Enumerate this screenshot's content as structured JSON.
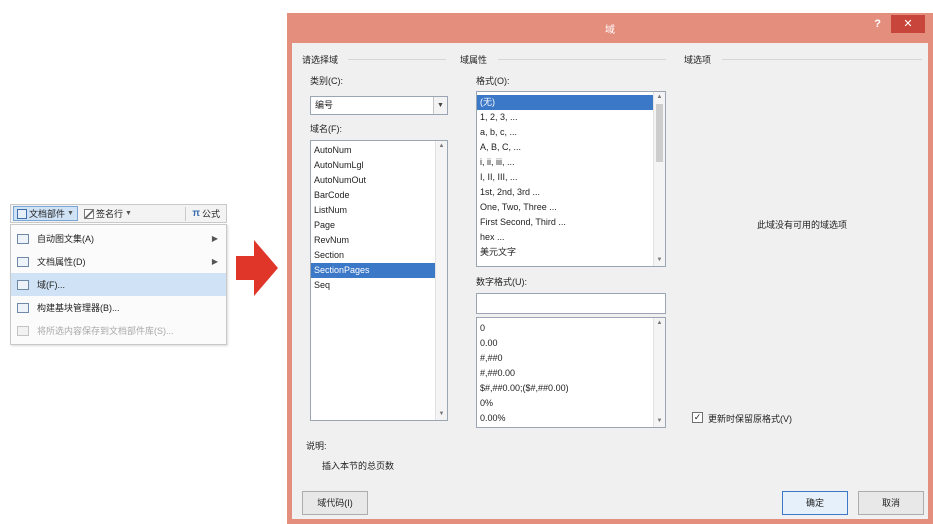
{
  "toolbar": {
    "items": [
      {
        "label": "文档部件",
        "icon": "document-parts-icon"
      },
      {
        "label": "签名行",
        "icon": "signature-line-icon"
      },
      {
        "label": "公式",
        "icon": "equation-icon"
      }
    ]
  },
  "menu": {
    "items": [
      {
        "label": "自动图文集(A)",
        "icon": "autotext-icon",
        "submenu": true
      },
      {
        "label": "文档属性(D)",
        "icon": "document-property-icon",
        "submenu": true
      },
      {
        "label": "域(F)...",
        "icon": "field-icon",
        "selected": true
      },
      {
        "label": "构建基块管理器(B)...",
        "icon": "building-blocks-icon"
      },
      {
        "label": "将所选内容保存到文档部件库(S)...",
        "icon": "save-selection-icon",
        "disabled": true
      }
    ]
  },
  "arrow_color": "#e0362a",
  "dialog": {
    "title": "域",
    "help": "?",
    "close": "✕",
    "accent": "#e48e7e",
    "choose_field": {
      "group_label": "请选择域",
      "category_label": "类别(C):",
      "category_value": "编号",
      "field_names_label": "域名(F):",
      "field_names": [
        "AutoNum",
        "AutoNumLgl",
        "AutoNumOut",
        "BarCode",
        "ListNum",
        "Page",
        "RevNum",
        "Section",
        "SectionPages",
        "Seq"
      ],
      "selected_field": "SectionPages"
    },
    "field_properties": {
      "group_label": "域属性",
      "format_label": "格式(O):",
      "formats": [
        "(无)",
        "1, 2, 3, ...",
        "a, b, c, ...",
        "A, B, C, ...",
        "i, ii, iii, ...",
        "I, II, III, ...",
        "1st, 2nd, 3rd ...",
        "One, Two, Three ...",
        "First Second, Third ...",
        "hex ...",
        "美元文字"
      ],
      "selected_format": "(无)",
      "numeric_format_label": "数字格式(U):",
      "numeric_format_value": "",
      "numeric_formats": [
        "0",
        "0.00",
        "#,##0",
        "#,##0.00",
        "$#,##0.00;($#,##0.00)",
        "0%",
        "0.00%"
      ]
    },
    "field_options": {
      "group_label": "域选项",
      "empty_message": "此域没有可用的域选项",
      "preserve_label": "更新时保留原格式(V)",
      "preserve_checked": true,
      "check_mark": "✓"
    },
    "description": {
      "label": "说明:",
      "text": "插入本节的总页数"
    },
    "buttons": {
      "field_codes": "域代码(I)",
      "ok": "确定",
      "cancel": "取消"
    }
  }
}
